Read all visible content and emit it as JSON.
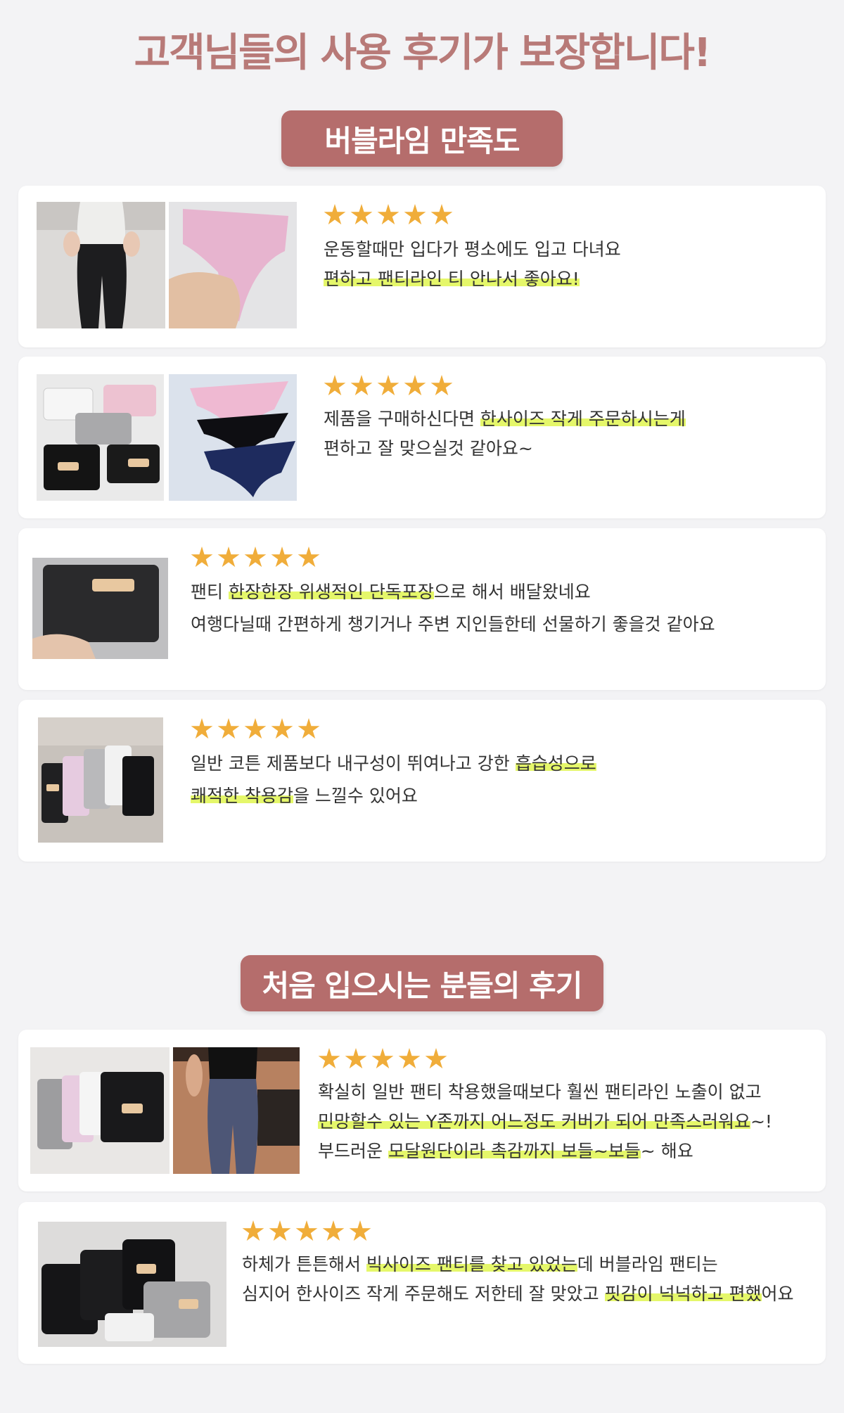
{
  "header": {
    "title": "고객님들의 사용 후기가 보장합니다!"
  },
  "sections": [
    {
      "badge": "버블라임 만족도"
    },
    {
      "badge": "처음 입으시는 분들의 후기"
    }
  ],
  "colors": {
    "accent": "#b56d6c",
    "star": "#f0ad3a",
    "highlight": "#e5f76a",
    "title": "#b87a78"
  },
  "reviews": [
    {
      "rating": 5,
      "lines": [
        [
          {
            "t": "운동할때만 입다가 평소에도 입고 다녀요"
          }
        ],
        [
          {
            "t": "편하고 팬티라인 티 안나서 좋아요!",
            "hl": true
          }
        ]
      ]
    },
    {
      "rating": 5,
      "lines": [
        [
          {
            "t": "제품을 구매하신다면 "
          },
          {
            "t": "한사이즈 작게 주문하시는게",
            "hl": true
          }
        ],
        [
          {
            "t": "편하고 잘 맞으실것 같아요~"
          }
        ]
      ]
    },
    {
      "rating": 5,
      "lines": [
        [
          {
            "t": "팬티 "
          },
          {
            "t": "한장한장 위생적인 단독포장",
            "hl": true
          },
          {
            "t": "으로 해서 배달왔네요"
          }
        ],
        [
          {
            "t": "여행다닐때 간편하게 챙기거나 주변 지인들한테 선물하기 좋을것 같아요"
          }
        ]
      ]
    },
    {
      "rating": 5,
      "lines": [
        [
          {
            "t": "일반 코튼 제품보다 내구성이 뛰여나고 강한 "
          },
          {
            "t": "흡습성으로",
            "hl": true
          }
        ],
        [
          {
            "t": "쾌적한 착용감",
            "hl": true
          },
          {
            "t": "을 느낄수 있어요"
          }
        ]
      ]
    },
    {
      "rating": 5,
      "lines": [
        [
          {
            "t": "확실히 일반 팬티 착용했을때보다 훨씬 팬티라인 노출이 없고"
          }
        ],
        [
          {
            "t": "민망할수 있는 Y존까지 어느정도 커버가 되어 만족스러워요",
            "hl": true
          },
          {
            "t": "~!"
          }
        ],
        [
          {
            "t": "부드러운 "
          },
          {
            "t": "모달원단이라 촉감까지 보들~보들",
            "hl": true
          },
          {
            "t": "~ 해요"
          }
        ]
      ]
    },
    {
      "rating": 5,
      "lines": [
        [
          {
            "t": "하체가 튼튼해서 "
          },
          {
            "t": "빅사이즈 팬티를 찾고 있었는",
            "hl": true
          },
          {
            "t": "데 버블라임 팬티는"
          }
        ],
        [
          {
            "t": "심지어 한사이즈 작게 주문해도 저한테 잘 맞았고 "
          },
          {
            "t": "핏감이 넉넉하고 편했",
            "hl": true
          },
          {
            "t": "어요"
          }
        ]
      ]
    }
  ],
  "photos": [
    {
      "name": "model-leggings-back-photo"
    },
    {
      "name": "pink-panty-in-hand-photo"
    },
    {
      "name": "packaged-panties-set-photo"
    },
    {
      "name": "panties-flatlay-photo"
    },
    {
      "name": "black-package-in-hand-photo"
    },
    {
      "name": "packages-on-floor-photo"
    },
    {
      "name": "packages-on-fabric-photo"
    },
    {
      "name": "model-gym-leggings-photo"
    },
    {
      "name": "packages-on-table-photo"
    }
  ]
}
